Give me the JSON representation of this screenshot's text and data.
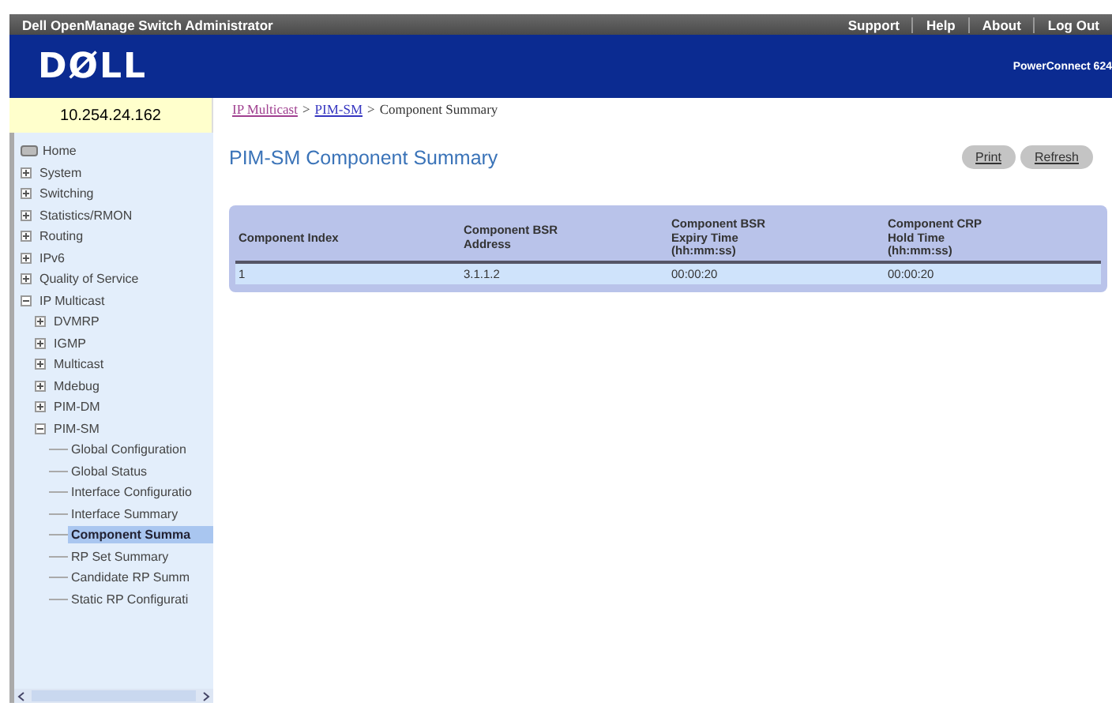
{
  "top_bar": {
    "title": "Dell OpenManage Switch Administrator",
    "links": [
      "Support",
      "Help",
      "About",
      "Log Out"
    ]
  },
  "header": {
    "logo": "DØLL",
    "product": "PowerConnect 624"
  },
  "ip_address": "10.254.24.162",
  "breadcrumb": {
    "links": [
      "IP Multicast",
      "PIM-SM"
    ],
    "separators": [
      ">",
      ">"
    ],
    "current": "Component Summary"
  },
  "sidebar": {
    "items": [
      {
        "label": "Home",
        "kind": "home"
      },
      {
        "label": "System",
        "kind": "folder",
        "expanded": false
      },
      {
        "label": "Switching",
        "kind": "folder",
        "expanded": false
      },
      {
        "label": "Statistics/RMON",
        "kind": "folder",
        "expanded": false
      },
      {
        "label": "Routing",
        "kind": "folder",
        "expanded": false
      },
      {
        "label": "IPv6",
        "kind": "folder",
        "expanded": false
      },
      {
        "label": "Quality of Service",
        "kind": "folder",
        "expanded": false
      },
      {
        "label": "IP Multicast",
        "kind": "folder",
        "expanded": true,
        "children": [
          {
            "label": "DVMRP",
            "kind": "folder",
            "expanded": false
          },
          {
            "label": "IGMP",
            "kind": "folder",
            "expanded": false
          },
          {
            "label": "Multicast",
            "kind": "folder",
            "expanded": false
          },
          {
            "label": "Mdebug",
            "kind": "folder",
            "expanded": false
          },
          {
            "label": "PIM-DM",
            "kind": "folder",
            "expanded": false
          },
          {
            "label": "PIM-SM",
            "kind": "folder",
            "expanded": true,
            "children": [
              {
                "label": "Global Configuration",
                "kind": "page",
                "selected": false
              },
              {
                "label": "Global Status",
                "kind": "page",
                "selected": false
              },
              {
                "label": "Interface Configuratio",
                "kind": "page",
                "selected": false
              },
              {
                "label": "Interface Summary",
                "kind": "page",
                "selected": false
              },
              {
                "label": "Component Summa",
                "kind": "page",
                "selected": true
              },
              {
                "label": "RP Set Summary",
                "kind": "page",
                "selected": false
              },
              {
                "label": "Candidate RP Summ",
                "kind": "page",
                "selected": false
              },
              {
                "label": "Static RP Configurati",
                "kind": "page",
                "selected": false
              }
            ]
          }
        ]
      }
    ]
  },
  "page_title": "PIM-SM Component Summary",
  "buttons": [
    "Print",
    "Refresh"
  ],
  "table": {
    "columns": [
      "Component Index",
      "Component BSR Address",
      "Component BSR Expiry Time (hh:mm:ss)",
      "Component CRP Hold Time (hh:mm:ss)"
    ],
    "rows": [
      [
        "1",
        "3.1.1.2",
        "00:00:20",
        "00:00:20"
      ]
    ]
  }
}
